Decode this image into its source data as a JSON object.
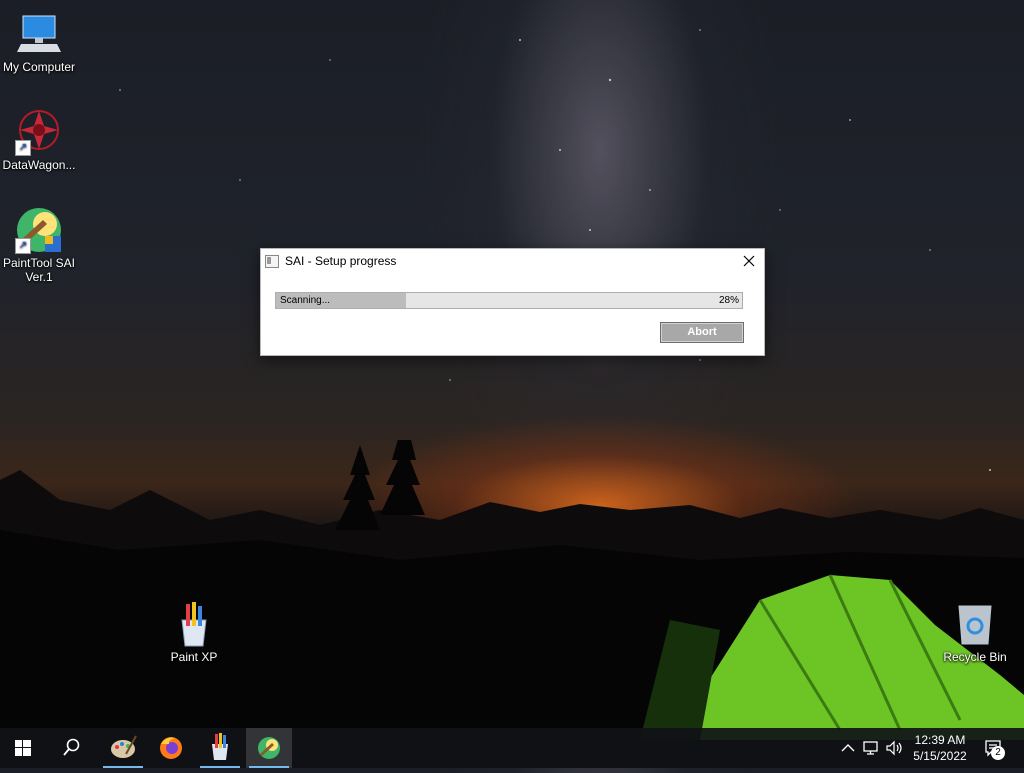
{
  "desktop": {
    "icons": [
      {
        "label": "My Computer"
      },
      {
        "label": "DataWagon..."
      },
      {
        "label": "PaintTool SAI\nVer.1"
      },
      {
        "label": "Paint XP"
      },
      {
        "label": "Recycle Bin"
      }
    ]
  },
  "dialog": {
    "title": "SAI - Setup progress",
    "progress": {
      "label": "Scanning...",
      "percent_text": "28%",
      "fraction": 0.28
    },
    "abort_label": "Abort"
  },
  "taskbar": {
    "items": [
      "start-icon",
      "search-icon",
      "paint-icon",
      "firefox-icon",
      "paint-xp-icon",
      "painttool-sai-icon"
    ],
    "clock": {
      "time": "12:39 AM",
      "date": "5/15/2022"
    },
    "notification_count": "2"
  },
  "colors": {
    "accent": "#76b9ed",
    "progress_fill": "#bcbcbc",
    "button": "#a8a8a8"
  }
}
